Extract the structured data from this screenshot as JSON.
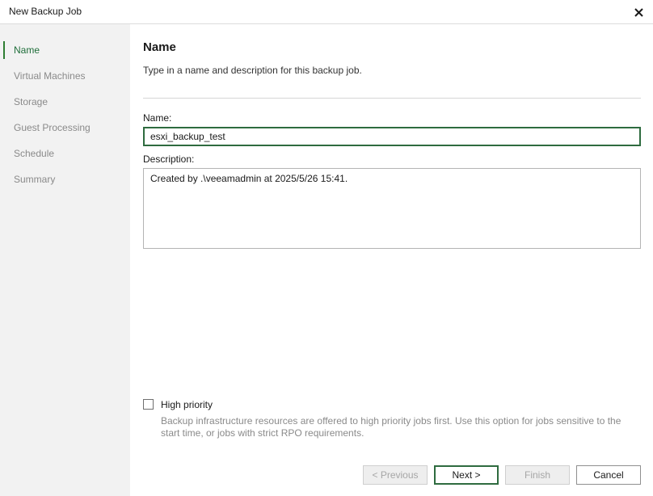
{
  "window": {
    "title": "New Backup Job",
    "close_icon": "close-icon"
  },
  "sidebar": {
    "items": [
      {
        "label": "Name",
        "active": true
      },
      {
        "label": "Virtual Machines",
        "active": false
      },
      {
        "label": "Storage",
        "active": false
      },
      {
        "label": "Guest Processing",
        "active": false
      },
      {
        "label": "Schedule",
        "active": false
      },
      {
        "label": "Summary",
        "active": false
      }
    ]
  },
  "main": {
    "heading": "Name",
    "subheading": "Type in a name and description for this backup job.",
    "name_label": "Name:",
    "name_value": "esxi_backup_test",
    "description_label": "Description:",
    "description_value": "Created by .\\veeamadmin at 2025/5/26 15:41.",
    "high_priority_label": "High priority",
    "high_priority_checked": false,
    "high_priority_help": "Backup infrastructure resources are offered to high priority jobs first. Use this option for jobs sensitive to the start time, or jobs with strict RPO requirements."
  },
  "footer": {
    "previous_label": "< Previous",
    "next_label": "Next >",
    "finish_label": "Finish",
    "cancel_label": "Cancel"
  },
  "colors": {
    "accent": "#2e7d32",
    "focus_border": "#2e6b3f",
    "sidebar_bg": "#f2f2f2"
  }
}
